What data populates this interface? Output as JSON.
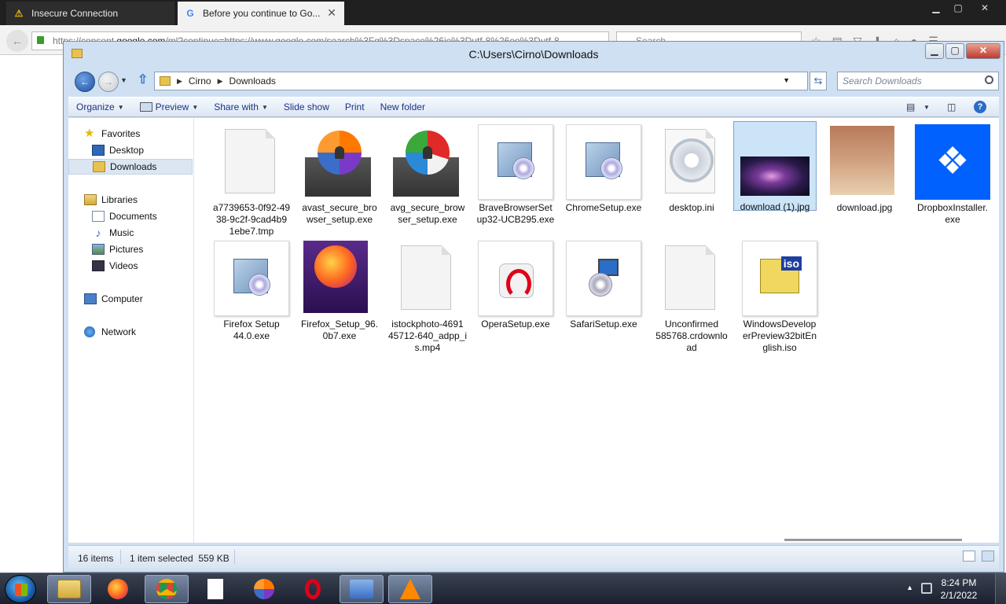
{
  "browser": {
    "tabs": [
      {
        "label": "Insecure Connection",
        "icon": "warning-icon"
      },
      {
        "label": "Before you continue to Go...",
        "icon": "google-icon"
      }
    ],
    "url": "https://consent.google.com/ml?continue=https://www.google.com/search%3Fq%3Dspace%26ie%3Dutf-8%26oe%3Dutf-8",
    "url_host": "google.com",
    "url_prefix": "https://consent.",
    "url_suffix": "/ml?continue=https://www.google.com/search%3Fq%3Dspace%26ie%3Dutf-8%26oe%3Dutf-8",
    "search_placeholder": "Search"
  },
  "explorer": {
    "title": "C:\\Users\\Cirno\\Downloads",
    "breadcrumb": [
      "Cirno",
      "Downloads"
    ],
    "search_placeholder": "Search Downloads",
    "toolbar": {
      "organize": "Organize",
      "preview": "Preview",
      "share_with": "Share with",
      "slide_show": "Slide show",
      "print": "Print",
      "new_folder": "New folder"
    },
    "nav": {
      "favorites": "Favorites",
      "desktop": "Desktop",
      "downloads": "Downloads",
      "libraries": "Libraries",
      "documents": "Documents",
      "music": "Music",
      "pictures": "Pictures",
      "videos": "Videos",
      "computer": "Computer",
      "network": "Network"
    },
    "files": [
      {
        "name": "a7739653-0f92-4938-9c2f-9cad4b91ebe7.tmp",
        "lines": [
          "a7739653-0f92-49",
          "38-9c2f-9cad4b9",
          "1ebe7.tmp"
        ],
        "icon": "blank-file-icon"
      },
      {
        "name": "avast_secure_browser_setup.exe",
        "lines": [
          "avast_secure_bro",
          "wser_setup.exe"
        ],
        "icon": "avast-secure-browser-icon"
      },
      {
        "name": "avg_secure_browser_setup.exe",
        "lines": [
          "avg_secure_brow",
          "ser_setup.exe"
        ],
        "icon": "avg-secure-browser-icon"
      },
      {
        "name": "BraveBrowserSetup32-UCB295.exe",
        "lines": [
          "BraveBrowserSet",
          "up32-UCB295.exe"
        ],
        "icon": "setup-installer-icon"
      },
      {
        "name": "ChromeSetup.exe",
        "lines": [
          "ChromeSetup.exe"
        ],
        "icon": "setup-installer-icon"
      },
      {
        "name": "desktop.ini",
        "lines": [
          "desktop.ini"
        ],
        "icon": "settings-file-icon"
      },
      {
        "name": "download (1).jpg",
        "lines": [
          "download (1).jpg"
        ],
        "icon": "galaxy-image-thumbnail",
        "selected": true
      },
      {
        "name": "download.jpg",
        "lines": [
          "download.jpg"
        ],
        "icon": "photo-thumbnail"
      },
      {
        "name": "DropboxInstaller.exe",
        "lines": [
          "DropboxInstaller.",
          "exe"
        ],
        "icon": "dropbox-icon"
      },
      {
        "name": "Firefox Setup 44.0.exe",
        "lines": [
          "Firefox Setup",
          "44.0.exe"
        ],
        "icon": "setup-installer-icon"
      },
      {
        "name": "Firefox_Setup_96.0b7.exe",
        "lines": [
          "Firefox_Setup_96.",
          "0b7.exe"
        ],
        "icon": "firefox-box-icon"
      },
      {
        "name": "istockphoto-469145712-640_adpp_is.mp4",
        "lines": [
          "istockphoto-4691",
          "45712-640_adpp_i",
          "s.mp4"
        ],
        "icon": "blank-file-icon"
      },
      {
        "name": "OperaSetup.exe",
        "lines": [
          "OperaSetup.exe"
        ],
        "icon": "opera-icon"
      },
      {
        "name": "SafariSetup.exe",
        "lines": [
          "SafariSetup.exe"
        ],
        "icon": "safari-setup-icon"
      },
      {
        "name": "Unconfirmed 585768.crdownload",
        "lines": [
          "Unconfirmed",
          "585768.crdownlo",
          "ad"
        ],
        "icon": "blank-file-icon"
      },
      {
        "name": "WindowsDeveloperPreview32bitEnglish.iso",
        "lines": [
          "WindowsDevelop",
          "erPreview32bitEn",
          "glish.iso"
        ],
        "icon": "iso-file-icon"
      }
    ],
    "status": {
      "count": "16 items",
      "selection": "1 item selected  559 KB"
    }
  },
  "taskbar": {
    "apps": [
      "explorer-icon",
      "firefox-icon",
      "chrome-icon",
      "file-icon",
      "avast-icon",
      "opera-icon",
      "control-panel-icon",
      "vlc-icon"
    ],
    "time": "8:24 PM",
    "date": "2/1/2022"
  }
}
